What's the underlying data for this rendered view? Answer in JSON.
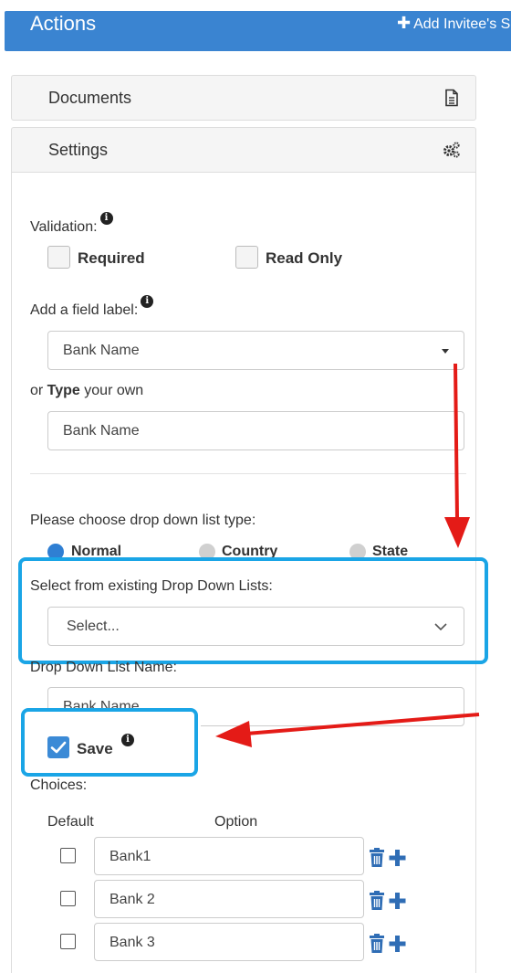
{
  "header": {
    "title": "Actions",
    "add_label": "Add Invitee's S"
  },
  "panels": {
    "documents_label": "Documents",
    "settings_label": "Settings"
  },
  "validation": {
    "label": "Validation:",
    "required_label": "Required",
    "read_only_label": "Read Only"
  },
  "field_label": {
    "label": "Add a field label:",
    "selected": "Bank Name",
    "type_prefix": "or ",
    "type_bold": "Type",
    "type_suffix": " your own",
    "custom_value": "Bank Name"
  },
  "dropdown_type": {
    "label": "Please choose drop down list type:",
    "options": [
      "Normal",
      "Country",
      "State"
    ],
    "selected": "Normal"
  },
  "existing_lists": {
    "label": "Select from existing Drop Down Lists:",
    "placeholder": "Select..."
  },
  "list_name": {
    "label": "Drop Down List Name:",
    "value": "Bank Name"
  },
  "save": {
    "label": "Save",
    "checked": true
  },
  "choices": {
    "label": "Choices:",
    "col_default": "Default",
    "col_option": "Option",
    "rows": [
      {
        "default": false,
        "option": "Bank1"
      },
      {
        "default": false,
        "option": "Bank 2"
      },
      {
        "default": false,
        "option": "Bank 3"
      }
    ]
  },
  "colors": {
    "header_bg": "#3a84d1",
    "highlight": "#1aa5e6",
    "arrow": "#e41b17",
    "radio_selected": "#2f7fd3",
    "radio_unselected": "#d0d0d0",
    "action_icons": "#2f6db5"
  },
  "icons": {
    "documents": "document-icon",
    "settings": "gears-icon",
    "info": "info-icon",
    "delete": "trash-icon",
    "add": "plus-icon"
  }
}
